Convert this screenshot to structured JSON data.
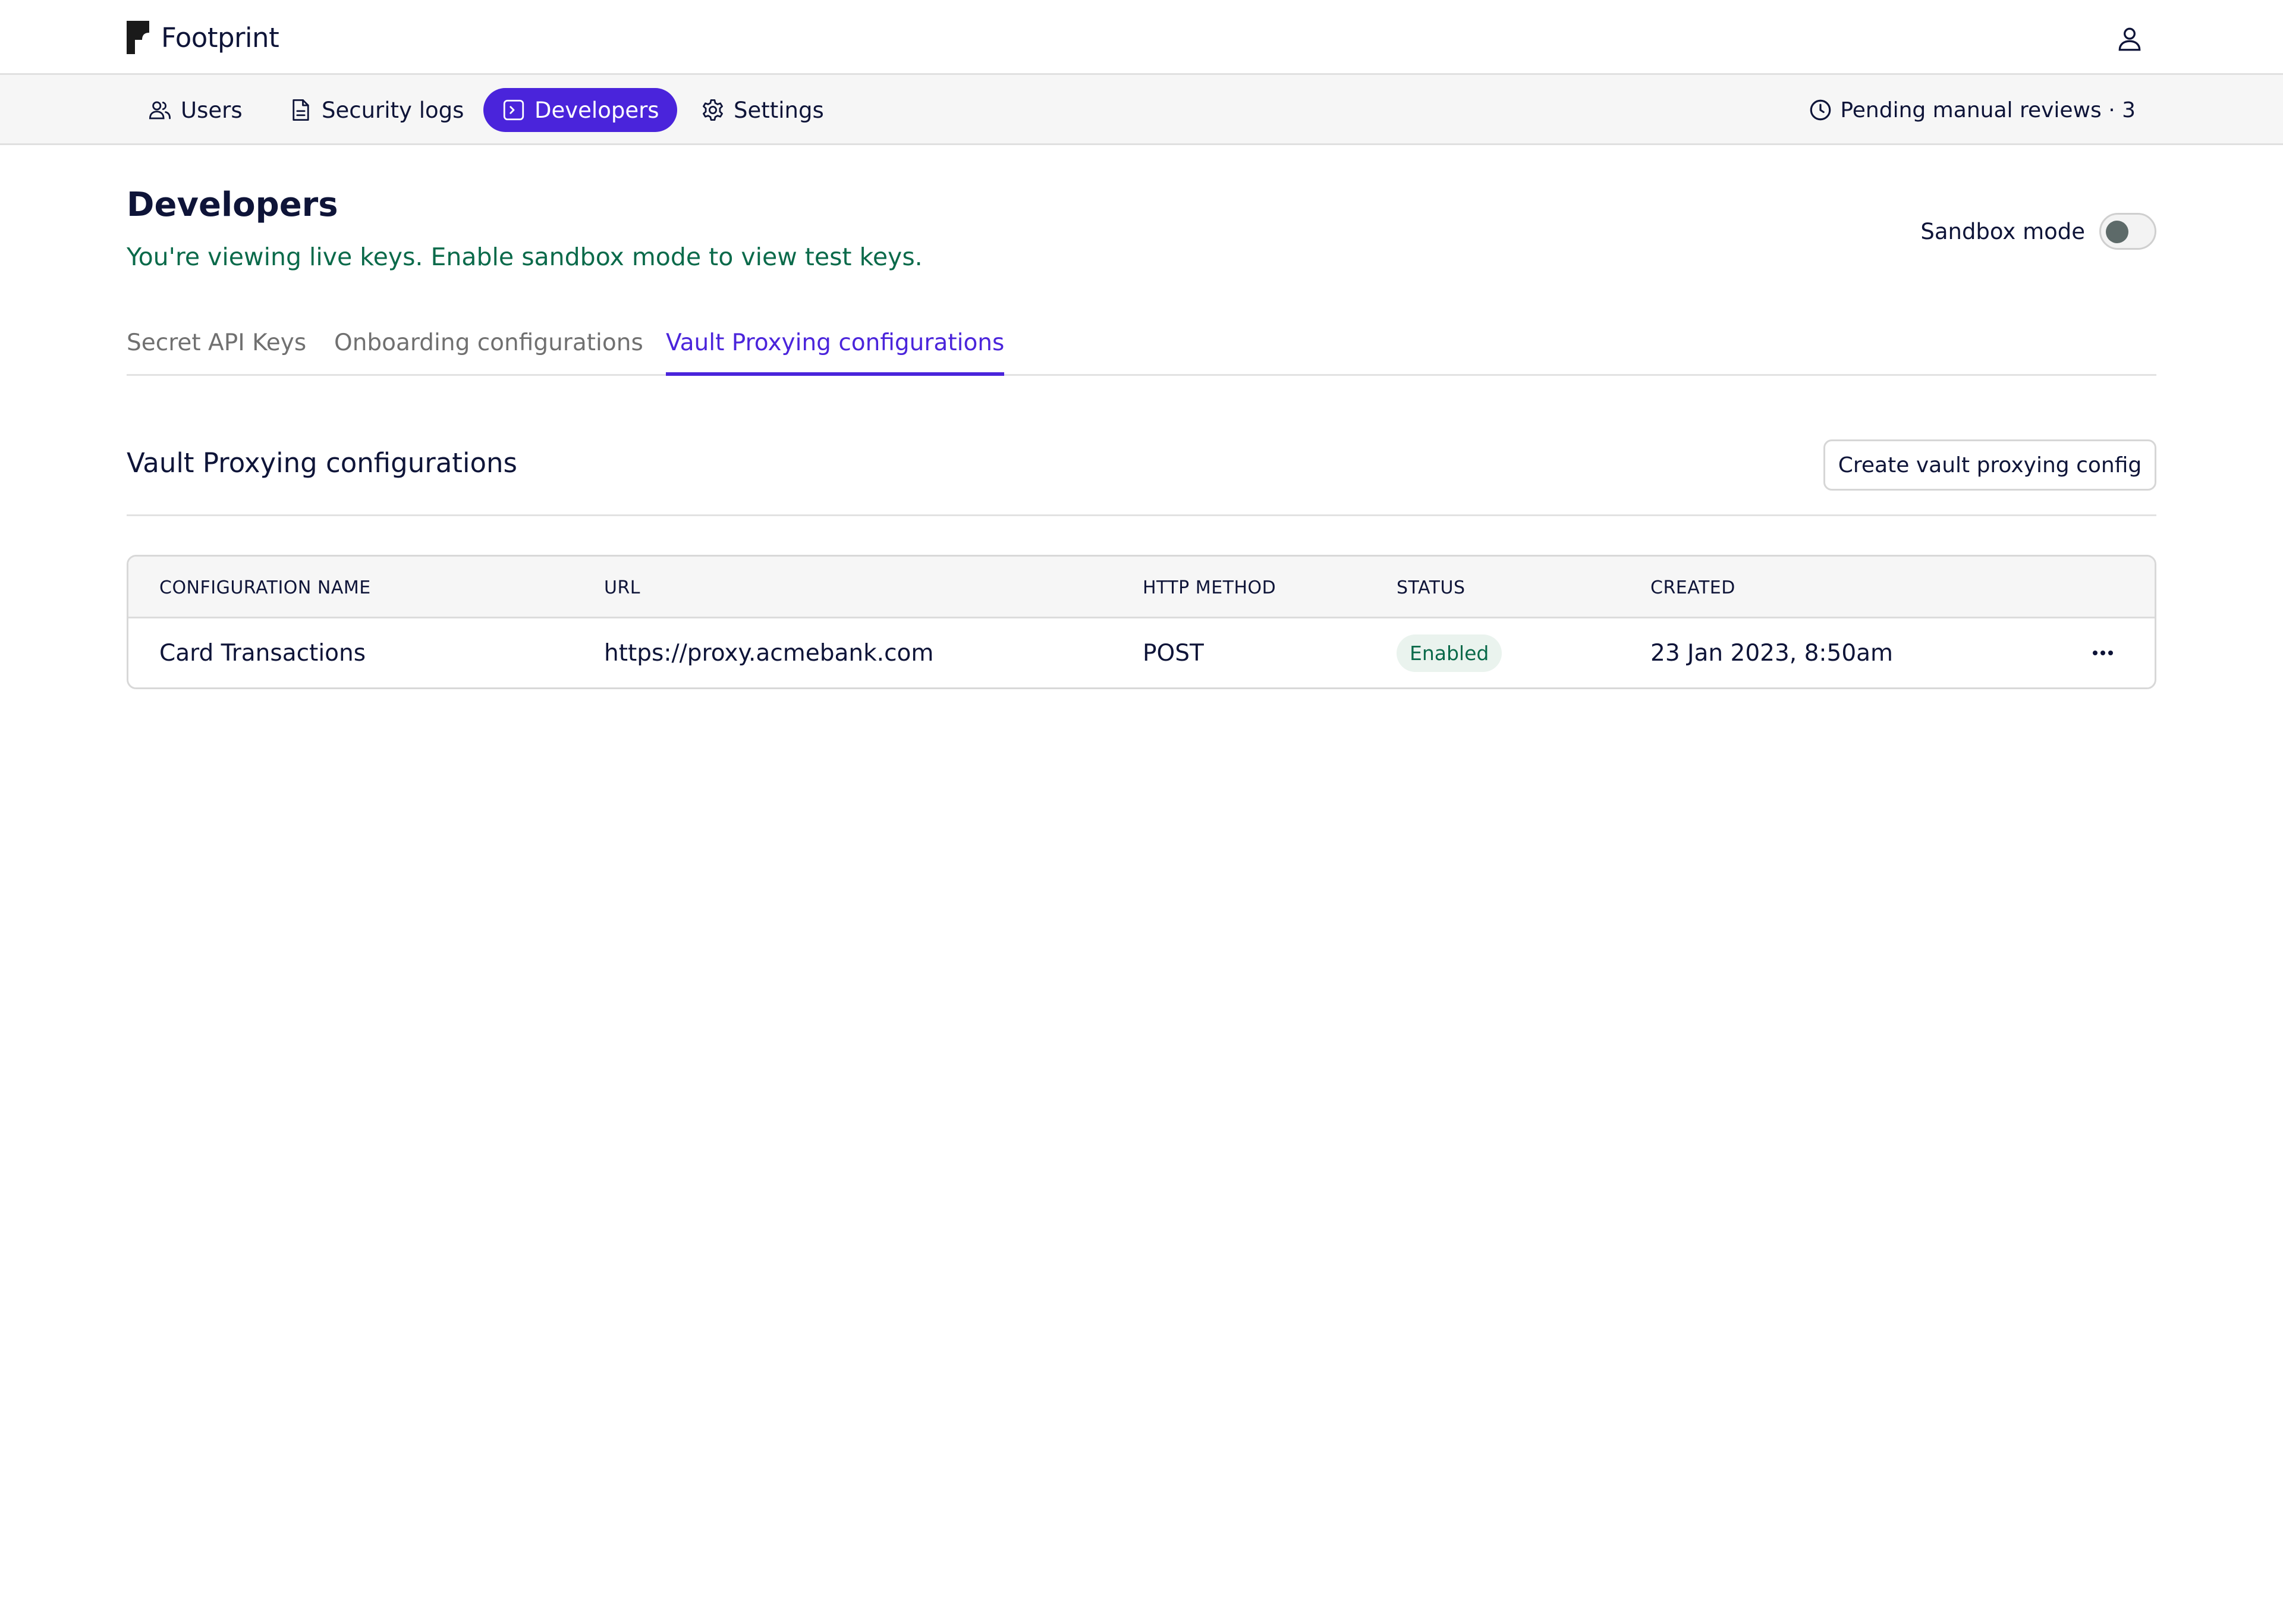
{
  "brand": {
    "name": "Footprint"
  },
  "nav": {
    "items": [
      {
        "label": "Users",
        "icon": "users-icon"
      },
      {
        "label": "Security logs",
        "icon": "file-text-icon"
      },
      {
        "label": "Developers",
        "icon": "terminal-icon",
        "active": true
      },
      {
        "label": "Settings",
        "icon": "gear-icon"
      }
    ],
    "pending_label": "Pending manual reviews · 3"
  },
  "page": {
    "title": "Developers",
    "subtitle": "You're viewing live keys. Enable sandbox mode to view test keys.",
    "sandbox_label": "Sandbox mode",
    "sandbox_enabled": false
  },
  "tabs": [
    {
      "label": "Secret API Keys"
    },
    {
      "label": "Onboarding configurations"
    },
    {
      "label": "Vault Proxying configurations",
      "active": true
    }
  ],
  "section": {
    "title": "Vault Proxying configurations",
    "create_label": "Create vault proxying config"
  },
  "table": {
    "columns": [
      "CONFIGURATION NAME",
      "URL",
      "HTTP METHOD",
      "STATUS",
      "CREATED"
    ],
    "rows": [
      {
        "name": "Card Transactions",
        "url": "https://proxy.acmebank.com",
        "method": "POST",
        "status": "Enabled",
        "created": "23 Jan 2023, 8:50am"
      }
    ]
  },
  "colors": {
    "accent": "#4a24db",
    "success_text": "#0a6a4a",
    "success_bg": "#eaf3ee",
    "text": "#0e1438"
  }
}
